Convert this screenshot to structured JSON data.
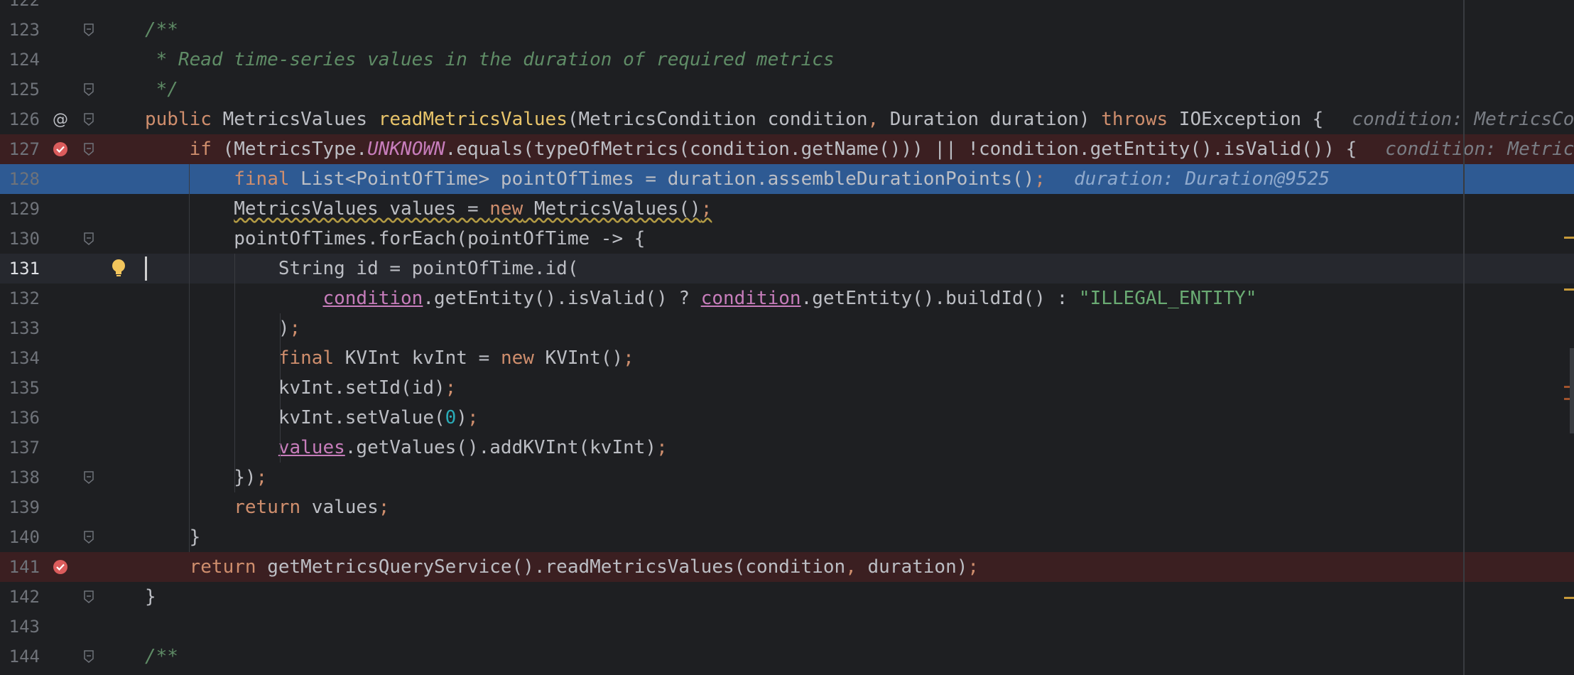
{
  "editor": {
    "lines": [
      {
        "n": "122",
        "html": ""
      },
      {
        "n": "123",
        "html": "<span class='doc'>/**</span>"
      },
      {
        "n": "124",
        "html": "<span class='doc'> * Read time-series values in the duration of required metrics</span>"
      },
      {
        "n": "125",
        "html": "<span class='doc'> */</span>"
      },
      {
        "n": "126",
        "html": "<span class='kw'>public</span> MetricsValues <span class='mdecl'>readMetricsValues</span>(MetricsCondition condition<span class='pun'>,</span> Duration duration) <span class='kw'>throws</span> IOException {<span class='hint'>condition: MetricsCondition</span>"
      },
      {
        "n": "127",
        "html": "    <span class='kw'>if</span> (MetricsType.<span class='konst'>UNKNOWN</span>.equals(typeOfMetrics(condition.getName())) || !condition.getEntity().isValid()) {<span class='hint'>condition: MetricsCondition</span>"
      },
      {
        "n": "128",
        "html": "        <span class='kw'>final</span> List&lt;PointOfTime&gt; pointOfTimes = duration.assembleDurationPoints()<span class='pun'>;</span><span class='hint'>duration: Duration@9525</span>"
      },
      {
        "n": "129",
        "html": "        <span class='warn'>MetricsValues values = <span class='kw'>new</span> MetricsValues()<span class='pun'>;</span></span>"
      },
      {
        "n": "130",
        "html": "        pointOfTimes.forEach(pointOfTime -&gt; {"
      },
      {
        "n": "131",
        "html": "            String id = pointOfTime.id("
      },
      {
        "n": "132",
        "html": "                <span class='vlink'>condition</span>.getEntity().isValid() ? <span class='vlink'>condition</span>.getEntity().buildId() : <span class='str'>\"ILLEGAL_ENTITY\"</span>"
      },
      {
        "n": "133",
        "html": "            )<span class='pun'>;</span>"
      },
      {
        "n": "134",
        "html": "            <span class='kw'>final</span> KVInt kvInt = <span class='kw'>new</span> KVInt()<span class='pun'>;</span>"
      },
      {
        "n": "135",
        "html": "            kvInt.setId(id)<span class='pun'>;</span>"
      },
      {
        "n": "136",
        "html": "            kvInt.setValue(<span class='num'>0</span>)<span class='pun'>;</span>"
      },
      {
        "n": "137",
        "html": "            <span class='vlink'>values</span>.getValues().addKVInt(kvInt)<span class='pun'>;</span>"
      },
      {
        "n": "138",
        "html": "        })<span class='pun'>;</span>"
      },
      {
        "n": "139",
        "html": "        <span class='kw'>return</span> values<span class='pun'>;</span>"
      },
      {
        "n": "140",
        "html": "    }"
      },
      {
        "n": "141",
        "html": "    <span class='kw'>return</span> getMetricsQueryService().readMetricsValues(condition<span class='pun'>,</span> duration)<span class='pun'>;</span>"
      },
      {
        "n": "142",
        "html": "}"
      },
      {
        "n": "143",
        "html": ""
      },
      {
        "n": "144",
        "html": "<span class='doc'>/**</span>"
      }
    ],
    "breakpoint_lines": [
      "127",
      "141"
    ],
    "selected_line": "128",
    "current_line": "131",
    "override_marker_line": "126",
    "intention_bulb_line": "131",
    "fold_lines": [
      "123",
      "125",
      "126",
      "127",
      "130",
      "138",
      "140",
      "142",
      "144"
    ],
    "colors": {
      "background": "#1e1f22",
      "breakpoint_line": "#3b1f21",
      "selected_line": "#2e5a93",
      "keyword": "#cf8e6d",
      "comment": "#5f8c66",
      "string": "#6aab73",
      "number": "#2aacb8"
    }
  }
}
